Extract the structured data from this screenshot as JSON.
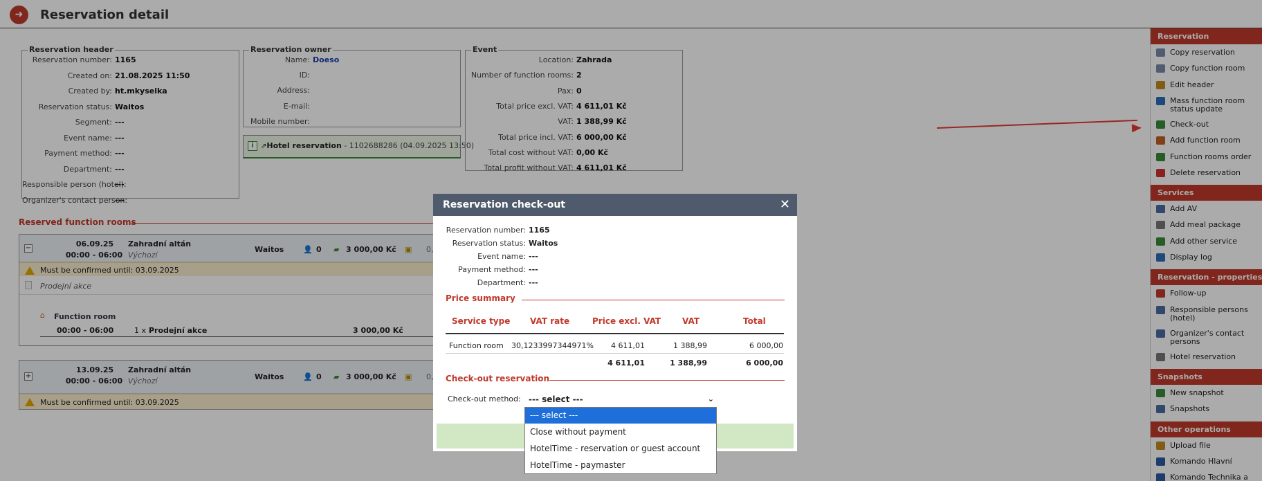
{
  "page": {
    "title": "Reservation detail",
    "back_icon": "arrow-right-icon"
  },
  "header_fs": {
    "legend": "Reservation header",
    "rows": [
      {
        "k": "Reservation number:",
        "v": "1165"
      },
      {
        "k": "Created on:",
        "v": "21.08.2025 11:50"
      },
      {
        "k": "Created by:",
        "v": "ht.mkyselka"
      },
      {
        "k": "Reservation status:",
        "v": "Waitos"
      },
      {
        "k": "Segment:",
        "v": "---"
      },
      {
        "k": "Event name:",
        "v": "---"
      },
      {
        "k": "Payment method:",
        "v": "---"
      },
      {
        "k": "Department:",
        "v": "---"
      },
      {
        "k": "Responsible person (hotel):",
        "v": "---"
      },
      {
        "k": "Organizer's contact person:",
        "v": "---"
      }
    ]
  },
  "owner_fs": {
    "legend": "Reservation owner",
    "rows": [
      {
        "k": "Name:",
        "v": "Doeso"
      },
      {
        "k": "ID:",
        "v": ""
      },
      {
        "k": "Address:",
        "v": ""
      },
      {
        "k": "E-mail:",
        "v": ""
      },
      {
        "k": "Mobile number:",
        "v": ""
      }
    ]
  },
  "hotel_res": {
    "label": "Hotel reservation",
    "detail": " - 1102688286 (04.09.2025 13:50)"
  },
  "event_fs": {
    "legend": "Event",
    "rows": [
      {
        "k": "Location:",
        "v": "Zahrada"
      },
      {
        "k": "Number of function rooms:",
        "v": "2"
      },
      {
        "k": "Pax:",
        "v": "0"
      },
      {
        "k": "Total price excl. VAT:",
        "v": "4 611,01 Kč"
      },
      {
        "k": "VAT:",
        "v": "1 388,99 Kč"
      },
      {
        "k": "Total price incl. VAT:",
        "v": "6 000,00 Kč"
      },
      {
        "k": "Total cost without VAT:",
        "v": "0,00 Kč"
      },
      {
        "k": "Total profit without VAT:",
        "v": "4 611,01 Kč"
      }
    ]
  },
  "frooms": {
    "title": "Reserved function rooms",
    "blocks": [
      {
        "toggle": "−",
        "date": "06.09.25",
        "time": "00:00 - 06:00",
        "room": "Zahradní altán",
        "sub": "Výchozí",
        "status": "Waitos",
        "pax": "0",
        "price": "3 000,00 Kč",
        "extra": "0,",
        "warn": "Must be confirmed until: 03.09.2025",
        "sales": "Prodejní akce",
        "fr_label": "Function room",
        "fr_time": "00:00 - 06:00",
        "fr_qty": "1 x",
        "fr_name": "Prodejní akce",
        "fr_price": "3 000,00 Kč"
      },
      {
        "toggle": "+",
        "date": "13.09.25",
        "time": "00:00 - 06:00",
        "room": "Zahradní altán",
        "sub": "Výchozí",
        "status": "Waitos",
        "pax": "0",
        "price": "3 000,00 Kč",
        "extra": "0,",
        "warn": "Must be confirmed until: 03.09.2025"
      }
    ]
  },
  "sidebar": {
    "sections": [
      {
        "head": "Reservation",
        "items": [
          "Copy reservation",
          "Copy function room",
          "Edit header",
          "Mass function room status update",
          "Check-out",
          "Add function room",
          "Function rooms order",
          "Delete reservation"
        ]
      },
      {
        "head": "Services",
        "items": [
          "Add AV",
          "Add meal package",
          "Add other service",
          "Display log"
        ]
      },
      {
        "head": "Reservation - properties",
        "items": [
          "Follow-up",
          "Responsible persons (hotel)",
          "Organizer's contact persons",
          "Hotel reservation"
        ]
      },
      {
        "head": "Snapshots",
        "items": [
          "New snapshot",
          "Snapshots"
        ]
      },
      {
        "head": "Other operations",
        "items": [
          "Upload file",
          "Komando Hlavní",
          "Komando Technika a pronájem"
        ]
      }
    ]
  },
  "modal": {
    "title": "Reservation check-out",
    "close": "✕",
    "rows": [
      {
        "k": "Reservation number:",
        "v": "1165"
      },
      {
        "k": "Reservation status:",
        "v": "Waitos"
      },
      {
        "k": "Event name:",
        "v": "---"
      },
      {
        "k": "Payment method:",
        "v": "---"
      },
      {
        "k": "Department:",
        "v": "---"
      }
    ],
    "price_summary": "Price summary",
    "headers": [
      "Service type",
      "VAT rate",
      "Price excl. VAT",
      "VAT",
      "Total"
    ],
    "row": {
      "type": "Function room",
      "rate": "30,1233997344971%",
      "excl": "4 611,01",
      "vat": "1 388,99",
      "total": "6 000,00"
    },
    "totals": {
      "excl": "4 611,01",
      "vat": "1 388,99",
      "total": "6 000,00"
    },
    "checkout_title": "Check-out reservation",
    "method_label": "Check-out method:",
    "method_value": "--- select ---",
    "options": [
      "--- select ---",
      "Close without payment",
      "HotelTime - reservation or guest account",
      "HotelTime - paymaster"
    ]
  },
  "colors": {
    "accent": "#c0392b",
    "modal_header": "#4f5b6c",
    "selected": "#1e6fd9",
    "annotation": "#e53935"
  }
}
